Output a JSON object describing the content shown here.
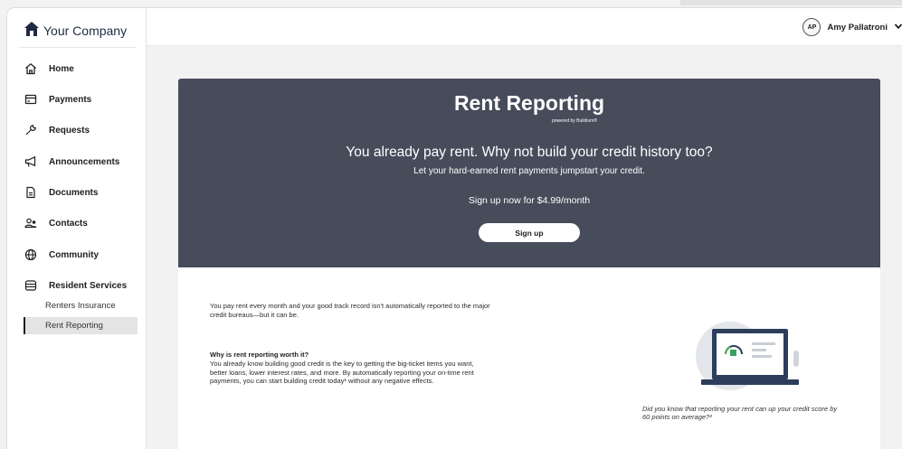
{
  "brand": {
    "name": "Your Company",
    "icon": "house-icon"
  },
  "sidebar": {
    "items": [
      {
        "label": "Home",
        "icon": "home-icon"
      },
      {
        "label": "Payments",
        "icon": "card-icon"
      },
      {
        "label": "Requests",
        "icon": "wrench-icon"
      },
      {
        "label": "Announcements",
        "icon": "megaphone-icon"
      },
      {
        "label": "Documents",
        "icon": "document-icon"
      },
      {
        "label": "Contacts",
        "icon": "contacts-icon"
      },
      {
        "label": "Community",
        "icon": "globe-icon"
      },
      {
        "label": "Resident Services",
        "icon": "services-icon"
      }
    ],
    "subitems": [
      {
        "label": "Renters Insurance"
      },
      {
        "label": "Rent Reporting",
        "active": true
      }
    ]
  },
  "user": {
    "initials": "AP",
    "name": "Amy Pallatroni"
  },
  "hero": {
    "title": "Rent Reporting",
    "powered_by": "powered by Buildium®",
    "headline": "You already pay rent. Why not build your credit history too?",
    "subheadline": "Let your hard-earned rent payments jumpstart your credit.",
    "price_text": "Sign up now for $4.99/month",
    "signup_label": "Sign up",
    "background": "#474c5b"
  },
  "content": {
    "intro": "You pay rent every month and your good track record isn't automatically reported to the major credit bureaus—but it can be.",
    "why_title": "Why is rent reporting worth it?",
    "why_body": "You already know building good credit is the key to getting the big-ticket items you want, better loans, lower interest rates, and more. By automatically reporting your on-time rent payments, you can start building credit today¹ without any negative effects.",
    "caption": "Did you know that reporting your rent can up your credit score by 60 points on average?²",
    "illustration": "laptop-credit-icon"
  }
}
